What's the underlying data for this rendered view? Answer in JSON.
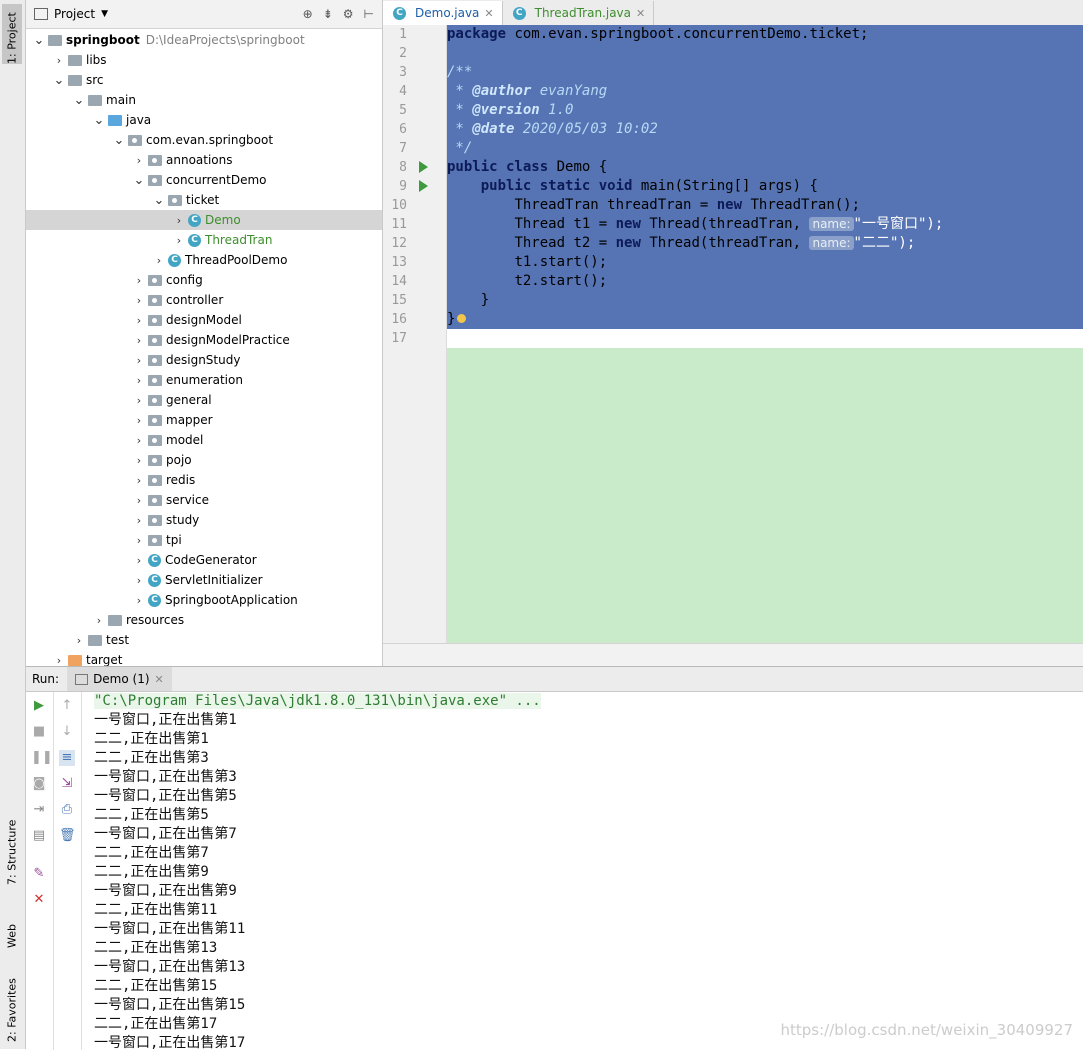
{
  "left_strip": {
    "tabs": [
      "1: Project",
      "7: Structure",
      "Web",
      "2: Favorites"
    ]
  },
  "project_panel": {
    "title": "Project",
    "tree": [
      {
        "label": "springboot",
        "hint": "D:\\IdeaProjects\\springboot",
        "depth": 0,
        "kind": "folder",
        "expanded": true
      },
      {
        "label": "libs",
        "depth": 1,
        "kind": "folder",
        "expanded": false
      },
      {
        "label": "src",
        "depth": 1,
        "kind": "folder",
        "expanded": true
      },
      {
        "label": "main",
        "depth": 2,
        "kind": "folder",
        "expanded": true
      },
      {
        "label": "java",
        "depth": 3,
        "kind": "folder-blue",
        "expanded": true
      },
      {
        "label": "com.evan.springboot",
        "depth": 4,
        "kind": "package",
        "expanded": true
      },
      {
        "label": "annoations",
        "depth": 5,
        "kind": "package",
        "expanded": false
      },
      {
        "label": "concurrentDemo",
        "depth": 5,
        "kind": "package",
        "expanded": true
      },
      {
        "label": "ticket",
        "depth": 6,
        "kind": "package",
        "expanded": true
      },
      {
        "label": "Demo",
        "depth": 7,
        "kind": "class-run",
        "expanded": false,
        "selected": true,
        "green": true
      },
      {
        "label": "ThreadTran",
        "depth": 7,
        "kind": "class",
        "expanded": false,
        "green": true
      },
      {
        "label": "ThreadPoolDemo",
        "depth": 6,
        "kind": "class-run",
        "expanded": false
      },
      {
        "label": "config",
        "depth": 5,
        "kind": "package",
        "expanded": false
      },
      {
        "label": "controller",
        "depth": 5,
        "kind": "package",
        "expanded": false
      },
      {
        "label": "designModel",
        "depth": 5,
        "kind": "package",
        "expanded": false
      },
      {
        "label": "designModelPractice",
        "depth": 5,
        "kind": "package",
        "expanded": false
      },
      {
        "label": "designStudy",
        "depth": 5,
        "kind": "package",
        "expanded": false
      },
      {
        "label": "enumeration",
        "depth": 5,
        "kind": "package",
        "expanded": false
      },
      {
        "label": "general",
        "depth": 5,
        "kind": "package",
        "expanded": false
      },
      {
        "label": "mapper",
        "depth": 5,
        "kind": "package",
        "expanded": false
      },
      {
        "label": "model",
        "depth": 5,
        "kind": "package",
        "expanded": false
      },
      {
        "label": "pojo",
        "depth": 5,
        "kind": "package",
        "expanded": false
      },
      {
        "label": "redis",
        "depth": 5,
        "kind": "package",
        "expanded": false
      },
      {
        "label": "service",
        "depth": 5,
        "kind": "package",
        "expanded": false
      },
      {
        "label": "study",
        "depth": 5,
        "kind": "package",
        "expanded": false
      },
      {
        "label": "tpi",
        "depth": 5,
        "kind": "package",
        "expanded": false
      },
      {
        "label": "CodeGenerator",
        "depth": 5,
        "kind": "class-run",
        "expanded": false
      },
      {
        "label": "ServletInitializer",
        "depth": 5,
        "kind": "class",
        "expanded": false
      },
      {
        "label": "SpringbootApplication",
        "depth": 5,
        "kind": "class-spring",
        "expanded": false
      },
      {
        "label": "resources",
        "depth": 3,
        "kind": "folder",
        "expanded": false
      },
      {
        "label": "test",
        "depth": 2,
        "kind": "folder",
        "expanded": false
      },
      {
        "label": "target",
        "depth": 1,
        "kind": "folder-orange",
        "expanded": false
      }
    ]
  },
  "editor": {
    "tabs": [
      {
        "label": "Demo.java",
        "active": true
      },
      {
        "label": "ThreadTran.java",
        "active": false
      }
    ],
    "line_numbers": [
      "1",
      "2",
      "3",
      "4",
      "5",
      "6",
      "7",
      "8",
      "9",
      "10",
      "11",
      "12",
      "13",
      "14",
      "15",
      "16",
      "17"
    ],
    "code": {
      "l1_kw": "package",
      "l1_rest": " com.evan.springboot.concurrentDemo.ticket;",
      "l3": "/**",
      "l4_pre": " * ",
      "l4_tag": "@author",
      "l4_rest": " evanYang",
      "l5_pre": " * ",
      "l5_tag": "@version",
      "l5_rest": " 1.0",
      "l6_pre": " * ",
      "l6_tag": "@date",
      "l6_rest": " 2020/05/03 10:02",
      "l7": " */",
      "l8_kw": "public class",
      "l8_rest": " Demo {",
      "l9_kw": "public static void",
      "l9_rest": " main(String[] args) {",
      "l10_a": "ThreadTran threadTran = ",
      "l10_kw": "new",
      "l10_b": " ThreadTran();",
      "l11_a": "Thread t1 = ",
      "l11_kw": "new",
      "l11_b": " Thread(threadTran, ",
      "l11_hint": "name:",
      "l11_str": "\"一号窗口\");",
      "l12_a": "Thread t2 = ",
      "l12_kw": "new",
      "l12_b": " Thread(threadTran, ",
      "l12_hint": "name:",
      "l12_str": "\"二二\");",
      "l13": "t1.start();",
      "l14": "t2.start();",
      "l15": "}",
      "l16": "}"
    }
  },
  "run_panel": {
    "label": "Run:",
    "tab": "Demo (1)",
    "console": [
      "\"C:\\Program Files\\Java\\jdk1.8.0_131\\bin\\java.exe\" ...",
      "一号窗口,正在出售第1",
      "二二,正在出售第1",
      "二二,正在出售第3",
      "一号窗口,正在出售第3",
      "一号窗口,正在出售第5",
      "二二,正在出售第5",
      "一号窗口,正在出售第7",
      "二二,正在出售第7",
      "二二,正在出售第9",
      "一号窗口,正在出售第9",
      "二二,正在出售第11",
      "一号窗口,正在出售第11",
      "二二,正在出售第13",
      "一号窗口,正在出售第13",
      "二二,正在出售第15",
      "一号窗口,正在出售第15",
      "二二,正在出售第17",
      "一号窗口,正在出售第17"
    ]
  },
  "watermark": "https://blog.csdn.net/weixin_30409927",
  "colors": {
    "selection": "#5674b3",
    "code_background": "#c9ebca",
    "keyword": "#0d1a58",
    "run_green": "#3d9a3d"
  }
}
